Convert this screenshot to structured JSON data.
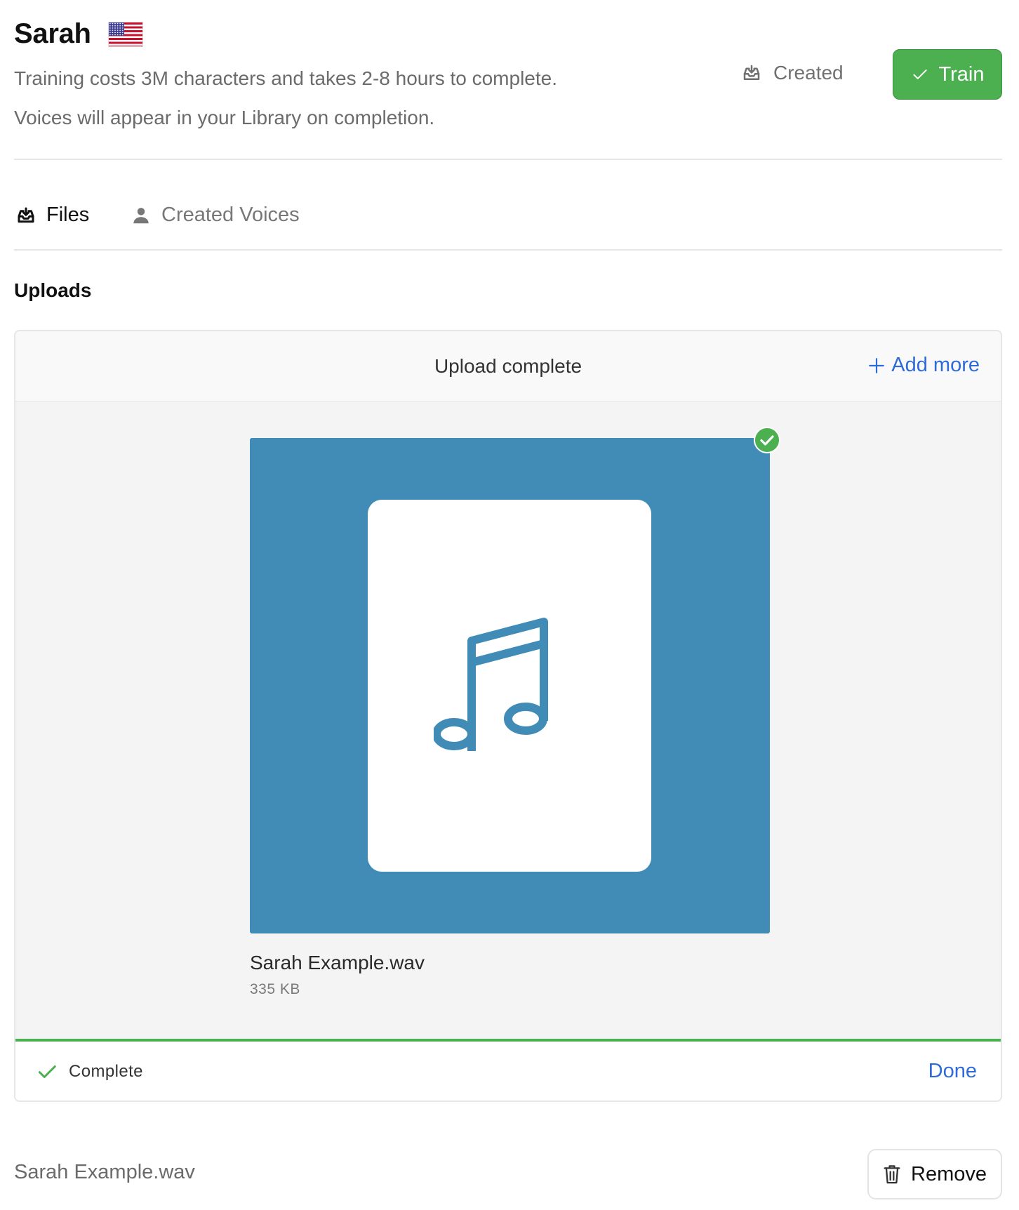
{
  "header": {
    "title": "Sarah",
    "flag_icon": "us-flag-icon",
    "description_line1": "Training costs 3M characters and takes 2-8 hours to complete.",
    "description_line2": "Voices will appear in your Library on completion.",
    "status_label": "Created",
    "train_label": "Train"
  },
  "tabs": [
    {
      "label": "Files",
      "icon": "inbox-download-icon",
      "active": true
    },
    {
      "label": "Created Voices",
      "icon": "person-icon",
      "active": false
    }
  ],
  "uploads": {
    "section_title": "Uploads",
    "panel_title": "Upload complete",
    "add_more_label": "Add more",
    "file": {
      "name": "Sarah Example.wav",
      "size": "335 KB",
      "thumbnail_icon": "music-note-icon"
    },
    "progress": 1.0,
    "status_label": "Complete",
    "done_label": "Done"
  },
  "file_row": {
    "name": "Sarah Example.wav",
    "remove_label": "Remove"
  },
  "colors": {
    "train_green": "#4caf50",
    "link_blue": "#2e6bd8",
    "preview_blue": "#408cb6"
  }
}
